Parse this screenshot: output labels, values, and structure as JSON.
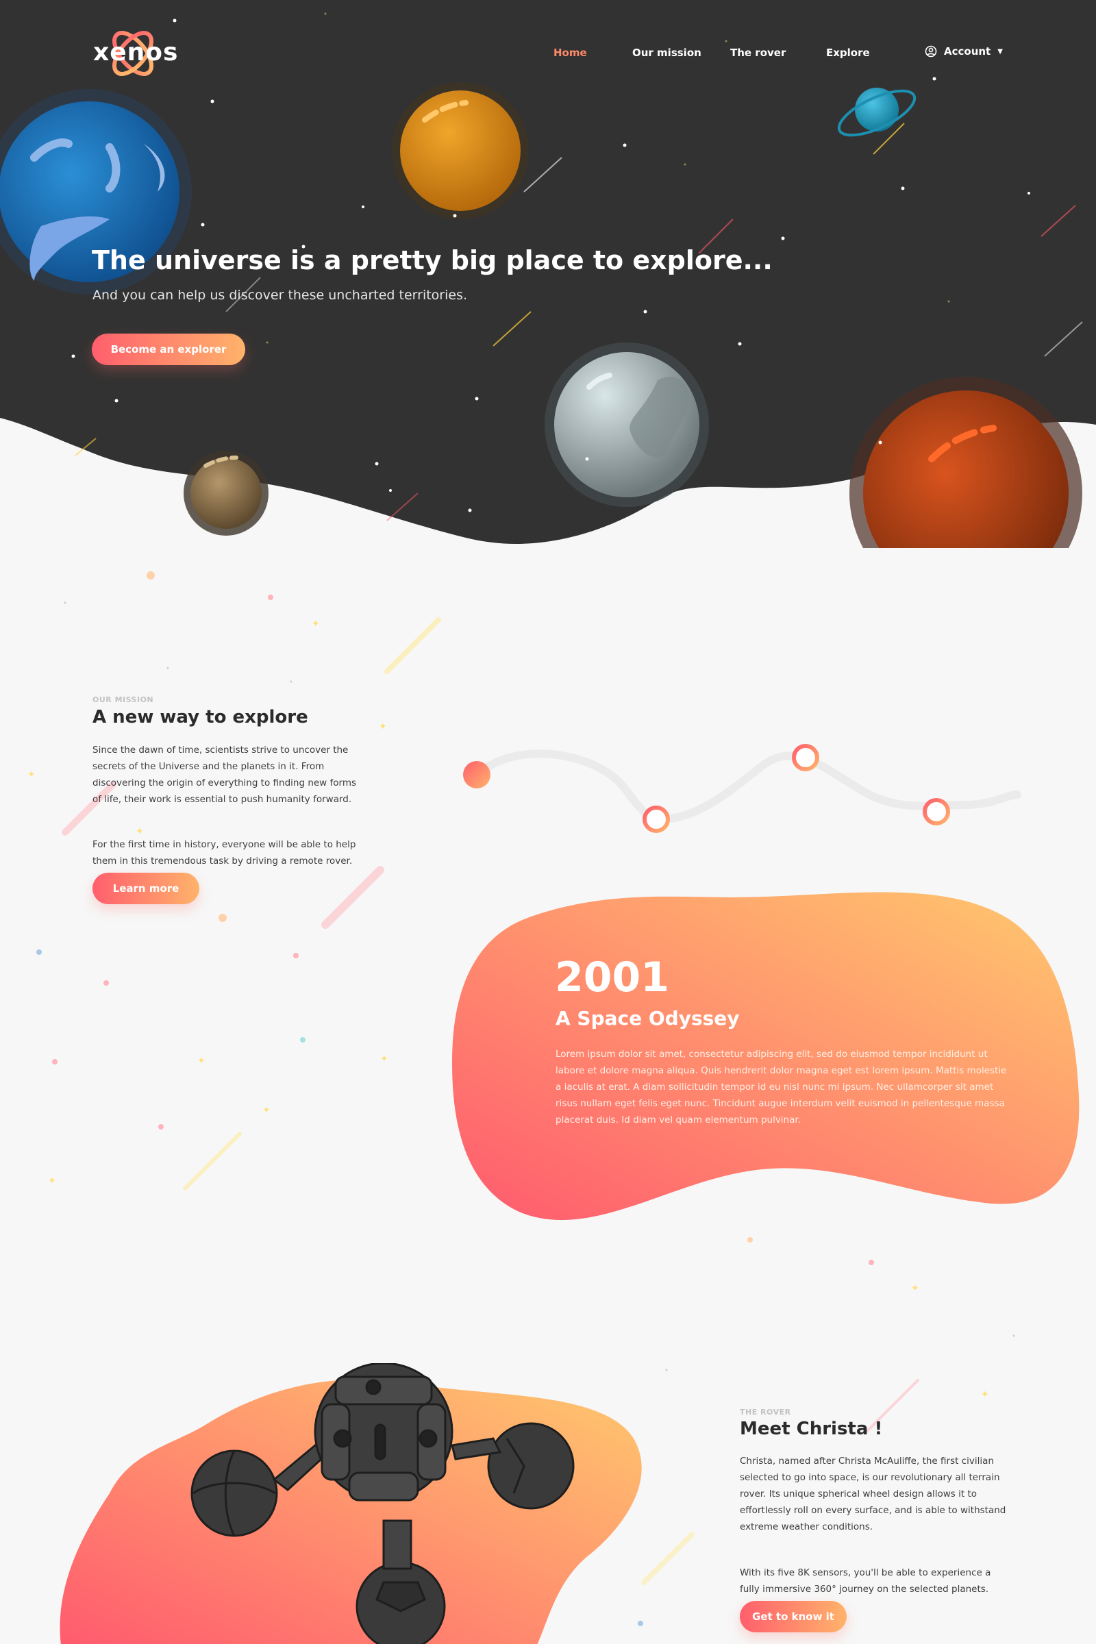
{
  "nav": {
    "logo": "xenos",
    "links": [
      "Home",
      "Our mission",
      "The rover",
      "Explore"
    ],
    "account": "Account"
  },
  "hero": {
    "title": "The universe is a pretty big place to explore...",
    "subtitle": "And you can help us discover these uncharted territories.",
    "cta": "Become an explorer"
  },
  "mission": {
    "eyebrow": "OUR MISSION",
    "title": "A new way to explore",
    "p1": "Since the dawn of time, scientists strive to uncover the secrets of the Universe and the planets in it. From discovering the origin of everything to finding new forms of life, their work is essential to push humanity forward.",
    "p2": "For the first time in history, everyone will be able to help them in this tremendous task by driving a remote rover.",
    "cta": "Learn more"
  },
  "odyssey": {
    "year": "2001",
    "title": "A Space Odyssey",
    "text": "Lorem ipsum dolor sit amet, consectetur adipiscing elit, sed do eiusmod tempor incididunt ut labore et dolore magna aliqua. Quis hendrerit dolor magna eget est lorem ipsum. Mattis molestie a iaculis at erat. A diam sollicitudin tempor id eu nisl nunc mi ipsum. Nec ullamcorper sit amet risus nullam eget felis eget nunc. Tincidunt augue interdum velit euismod in pellentesque massa placerat duis. Id diam vel quam elementum pulvinar."
  },
  "rover": {
    "eyebrow": "THE ROVER",
    "title": "Meet Christa !",
    "p1": "Christa, named after Christa McAuliffe, the first civilian selected to go into space, is our revolutionary all terrain rover. Its unique spherical wheel design allows it to effortlessly roll on every surface, and is able to withstand extreme weather conditions.",
    "p2": "With its five 8K sensors, you'll be able to experience a fully immersive 360° journey on the selected planets.",
    "cta": "Get to know it"
  },
  "colors": {
    "hero_bg": "#333232",
    "page_bg": "#f7f7f7",
    "accent_start": "#ff5f6d",
    "accent_end": "#ffc36b",
    "nav_active": "#ff8a6a"
  },
  "icons": [
    "logo-orbit-icon",
    "user-circle-icon",
    "caret-down-icon"
  ]
}
